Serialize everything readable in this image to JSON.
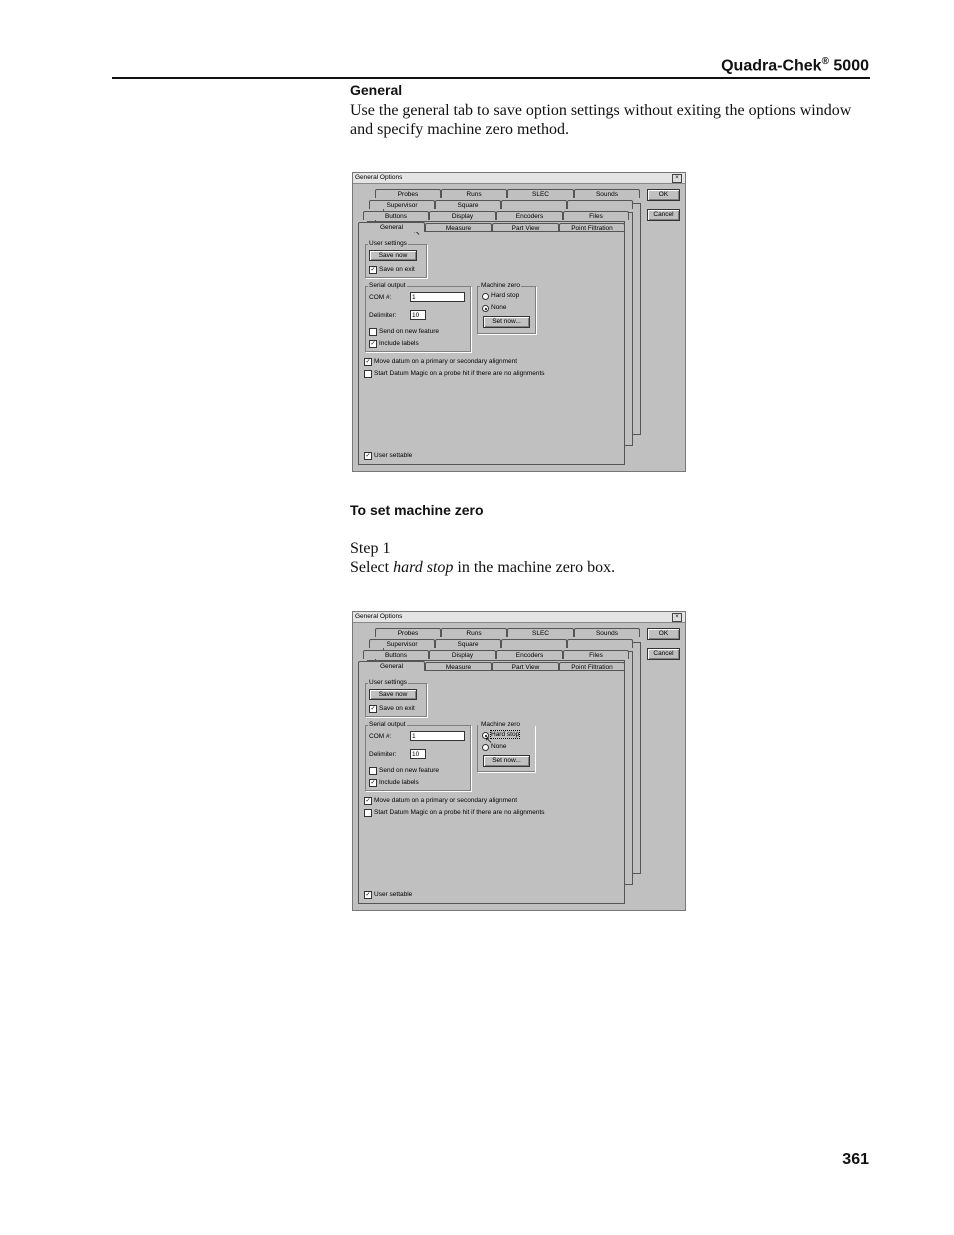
{
  "header": {
    "title": "Quadra-Chek",
    "registered": "®",
    "model": "5000"
  },
  "page_number": "361",
  "section1": {
    "heading": "General",
    "body_line1": "Use the general tab to save option settings without exiting the options window",
    "body_line2": "and specify machine zero method."
  },
  "section2": {
    "heading": "To set machine zero",
    "step": "Step 1",
    "instr_pre": "Select ",
    "instr_em": "hard stop",
    "instr_post": " in the machine zero box."
  },
  "dialog": {
    "title": "General Options",
    "close": "×",
    "ok": "OK",
    "cancel": "Cancel",
    "tabs_row1": [
      "Probes",
      "Runs",
      "SLEC",
      "Sounds"
    ],
    "tabs_row2": [
      "Supervisor",
      "Square"
    ],
    "tabs_row3": [
      "Buttons",
      "Display",
      "Encoders",
      "Files"
    ],
    "tabs_row4": [
      "General",
      "Measure",
      "Part View",
      "Point Filtration"
    ],
    "user_settings": "User settings",
    "save_now": "Save now",
    "save_on_exit": "Save on exit",
    "serial_output": "Serial output",
    "com_label": "COM #:",
    "com_value": "1",
    "delimiter_label": "Delimiter:",
    "delimiter_value": "10",
    "send_on_new_feature": "Send on new feature",
    "include_labels": "Include labels",
    "machine_zero": "Machine zero",
    "hard_stop": "Hard stop",
    "none": "None",
    "set_now": "Set now...",
    "move_datum": "Move datum on a primary or secondary alignment",
    "start_datum_magic": "Start Datum Magic on a probe hit if there are no alignments",
    "user_settable": "User settable",
    "check_mark": "✓"
  }
}
